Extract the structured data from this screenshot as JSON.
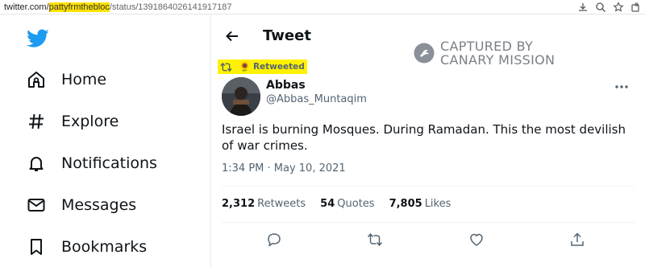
{
  "browser": {
    "url_domain": "twitter.com/",
    "url_highlight": "pattyfrmthebloc",
    "url_rest": "/status/1391864026141917187",
    "icons": [
      "download-icon",
      "zoom-icon",
      "bookmark-star-icon",
      "extensions-icon"
    ]
  },
  "sidebar": {
    "logo": "twitter-bird-icon",
    "items": [
      {
        "label": "Home",
        "icon": "home-icon"
      },
      {
        "label": "Explore",
        "icon": "hashtag-icon"
      },
      {
        "label": "Notifications",
        "icon": "bell-icon"
      },
      {
        "label": "Messages",
        "icon": "envelope-icon"
      },
      {
        "label": "Bookmarks",
        "icon": "bookmark-icon"
      }
    ]
  },
  "header": {
    "title": "Tweet"
  },
  "watermark": {
    "line1": "CAPTURED BY",
    "line2": "CANARY MISSION"
  },
  "retweet": {
    "label": "Retweeted",
    "emoji": "🌻"
  },
  "tweet": {
    "author_name": "Abbas",
    "author_handle": "@Abbas_Muntaqim",
    "text": "Israel is burning Mosques. During Ramadan. This the most devilish of war crimes.",
    "timestamp": "1:34 PM · May 10, 2021"
  },
  "stats": [
    {
      "count": "2,312",
      "label": "Retweets"
    },
    {
      "count": "54",
      "label": "Quotes"
    },
    {
      "count": "7,805",
      "label": "Likes"
    }
  ],
  "actions": [
    "reply-icon",
    "retweet-icon",
    "like-icon",
    "share-icon"
  ],
  "colors": {
    "twitter_blue": "#1d9bf0",
    "highlight": "#fff200",
    "text_primary": "#0f1419",
    "text_secondary": "#536471"
  }
}
